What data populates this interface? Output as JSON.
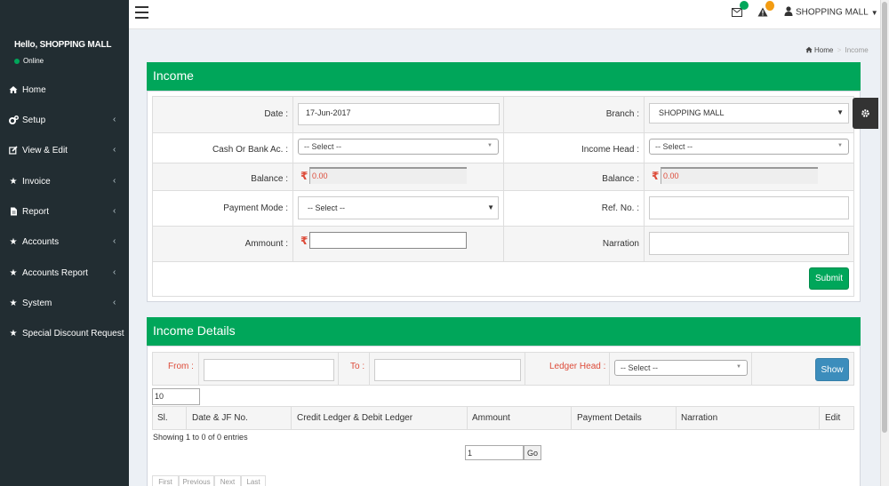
{
  "topbar": {
    "user_label": "SHOPPING MALL"
  },
  "sidebar": {
    "hello": "Hello, SHOPPING MALL",
    "status": "Online",
    "items": [
      {
        "label": "Home",
        "icon": "home-icon"
      },
      {
        "label": "Setup",
        "icon": "cogs-icon"
      },
      {
        "label": "View & Edit",
        "icon": "edit-icon"
      },
      {
        "label": "Invoice",
        "icon": "star-icon"
      },
      {
        "label": "Report",
        "icon": "file-icon"
      },
      {
        "label": "Accounts",
        "icon": "star-icon"
      },
      {
        "label": "Accounts Report",
        "icon": "star-icon"
      },
      {
        "label": "System",
        "icon": "star-icon"
      },
      {
        "label": "Special Discount Request",
        "icon": "star-icon"
      }
    ]
  },
  "breadcrumb": {
    "home": "Home",
    "sep": ">",
    "current": "Income"
  },
  "income": {
    "title": "Income",
    "date_label": "Date :",
    "date_value": "17-Jun-2017",
    "branch_label": "Branch :",
    "branch_value": "SHOPPING MALL",
    "cash_label": "Cash Or Bank Ac. :",
    "cash_value": "-- Select --",
    "income_head_label": "Income Head :",
    "income_head_value": "-- Select --",
    "balance_label": "Balance :",
    "balance_left": "0.00",
    "balance_right": "0.00",
    "payment_mode_label": "Payment Mode :",
    "payment_mode_value": "-- Select --",
    "ref_label": "Ref. No. :",
    "amount_label": "Ammount :",
    "narration_label": "Narration",
    "rupee": "₹",
    "submit": "Submit"
  },
  "details": {
    "title": "Income Details",
    "from_label": "From :",
    "to_label": "To :",
    "ledger_label": "Ledger Head :",
    "ledger_value": "-- Select --",
    "show": "Show",
    "page_size": "10",
    "columns": [
      "Sl.",
      "Date & JF No.",
      "Credit Ledger & Debit Ledger",
      "Ammount",
      "Payment Details",
      "Narration",
      "Edit"
    ],
    "info": "Showing 1 to 0 of 0 entries",
    "page_input": "1",
    "go": "Go",
    "pager": [
      "First",
      "Previous",
      "Next",
      "Last"
    ]
  },
  "colors": {
    "accent": "#00a65a",
    "sidebar": "#222d32",
    "primary": "#3c8dbc"
  }
}
